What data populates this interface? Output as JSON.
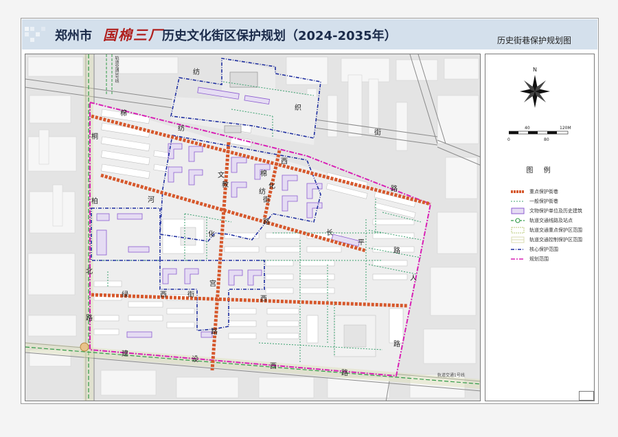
{
  "header": {
    "title_prefix": "郑州市",
    "title_brand": "国棉三厂",
    "title_main": "历史文化街区保护规划（2024-2035年）",
    "subtitle": "历史街巷保护规划图"
  },
  "map": {
    "north_label": "N",
    "scale": {
      "labels": [
        "0",
        "40",
        "80",
        "120M"
      ]
    },
    "street_labels": [
      {
        "id": "fang",
        "text": "纺"
      },
      {
        "id": "zhi",
        "text": "织"
      },
      {
        "id": "jie-n",
        "text": "街"
      },
      {
        "id": "mian",
        "text": "棉"
      },
      {
        "id": "fang2",
        "text": "纺"
      },
      {
        "id": "xi-n",
        "text": "西"
      },
      {
        "id": "lu-n",
        "text": "路"
      },
      {
        "id": "tong",
        "text": "桐"
      },
      {
        "id": "bai",
        "text": "柏"
      },
      {
        "id": "bei",
        "text": "北"
      },
      {
        "id": "lu-w",
        "text": "路"
      },
      {
        "id": "he",
        "text": "河"
      },
      {
        "id": "wen",
        "text": "文"
      },
      {
        "id": "hua-e",
        "text": "化"
      },
      {
        "id": "jiao",
        "text": "教"
      },
      {
        "id": "hua",
        "text": "化"
      },
      {
        "id": "gong",
        "text": "宫"
      },
      {
        "id": "lu-c",
        "text": "路"
      },
      {
        "id": "mian2",
        "text": "棉"
      },
      {
        "id": "fang3",
        "text": "纺"
      },
      {
        "id": "jie-c",
        "text": "街"
      },
      {
        "id": "lu-c2",
        "text": "路"
      },
      {
        "id": "chang",
        "text": "长"
      },
      {
        "id": "ping",
        "text": "平"
      },
      {
        "id": "lu-d",
        "text": "路"
      },
      {
        "id": "lv",
        "text": "绿"
      },
      {
        "id": "xi-c",
        "text": "西"
      },
      {
        "id": "jie-s",
        "text": "街"
      },
      {
        "id": "xi-c2",
        "text": "西"
      },
      {
        "id": "ren",
        "text": "人"
      },
      {
        "id": "lu-e",
        "text": "路"
      },
      {
        "id": "jian",
        "text": "建"
      },
      {
        "id": "she",
        "text": "设"
      },
      {
        "id": "xi-s",
        "text": "西"
      },
      {
        "id": "lu-s",
        "text": "路"
      }
    ],
    "transit_labels": [
      "轨道交通3号线",
      "轨道交通1号线"
    ]
  },
  "legend": {
    "title": "图  例",
    "items": [
      {
        "label": "重点保护街巷",
        "style": "key-street",
        "color": "#d6582c"
      },
      {
        "label": "一般保护街巷",
        "style": "general-street",
        "color": "#39a06e"
      },
      {
        "label": "文物保护单位及历史建筑",
        "style": "heritage",
        "color": "#8b5bd0"
      },
      {
        "label": "轨道交通线路及站点",
        "style": "transit",
        "color": "#2f9a46"
      },
      {
        "label": "轨道交通重点保护区范围",
        "style": "transit-key",
        "color": "#b9c97a"
      },
      {
        "label": "轨道交通控制保护区范围",
        "style": "transit-control",
        "color": "#d9dbb0"
      },
      {
        "label": "核心保护范围",
        "style": "core",
        "color": "#1f2fa0"
      },
      {
        "label": "规划范围",
        "style": "planning",
        "color": "#d81fb5"
      }
    ]
  }
}
